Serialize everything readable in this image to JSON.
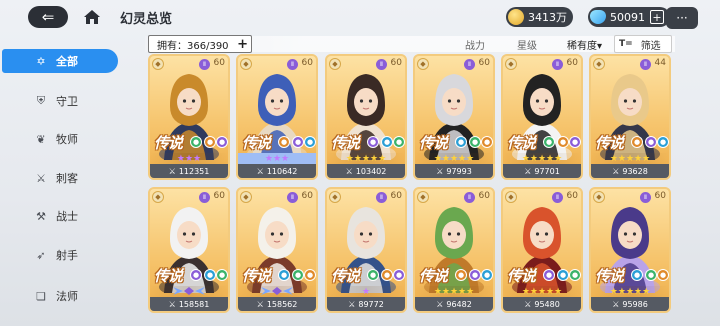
{
  "header": {
    "back_icon": "back-arrow-icon",
    "home_icon": "home-icon",
    "title": "幻灵总览",
    "gold": "3413万",
    "gems": "50091",
    "plus": "+",
    "chat_icon": "chat-icon"
  },
  "sidebar": {
    "items": [
      {
        "label": "全部",
        "icon": "star-icon",
        "glyph": "✡"
      },
      {
        "label": "守卫",
        "icon": "shield-icon",
        "glyph": "⛨"
      },
      {
        "label": "牧师",
        "icon": "wings-icon",
        "glyph": "❦"
      },
      {
        "label": "刺客",
        "icon": "dagger-icon",
        "glyph": "⚔"
      },
      {
        "label": "战士",
        "icon": "sword-icon",
        "glyph": "⚒"
      },
      {
        "label": "射手",
        "icon": "bow-icon",
        "glyph": "➶"
      },
      {
        "label": "法师",
        "icon": "book-icon",
        "glyph": "❏"
      }
    ]
  },
  "toolbar": {
    "owned": "拥有：366/390",
    "owned_plus": "+",
    "sort_power": "战力",
    "sort_star": "星级",
    "sort_rarity": "稀有度▾",
    "filter_icon": "T=",
    "filter": "筛选"
  },
  "cards": [
    {
      "level": "60",
      "rarity": "传说",
      "stars": "★★★",
      "star_style": "purple",
      "power": "112351",
      "colors": [
        "#c98a2b",
        "#2f3a5e"
      ]
    },
    {
      "level": "60",
      "rarity": "传说",
      "stars": "★★★",
      "star_style": "bluebar",
      "power": "110642",
      "colors": [
        "#3e5fb8",
        "#e8d9c2"
      ]
    },
    {
      "level": "60",
      "rarity": "传说",
      "stars": "★★★★★",
      "star_style": "gold",
      "power": "103402",
      "colors": [
        "#3a2a25",
        "#f0e2d0"
      ]
    },
    {
      "level": "60",
      "rarity": "传说",
      "stars": "★★★★★",
      "star_style": "gold",
      "power": "97993",
      "colors": [
        "#d8d8dc",
        "#222"
      ]
    },
    {
      "level": "60",
      "rarity": "传说",
      "stars": "★★★★★",
      "star_style": "gold",
      "power": "97701",
      "colors": [
        "#222",
        "#f3f3f3"
      ]
    },
    {
      "level": "44",
      "rarity": "传说",
      "stars": "★★★★★",
      "star_style": "gold",
      "power": "93628",
      "colors": [
        "#e9c98a",
        "#34374a"
      ]
    },
    {
      "level": "60",
      "rarity": "传说",
      "stars": "",
      "star_style": "gold",
      "power": "158581",
      "colors": [
        "#f2f2f2",
        "#3a3030"
      ]
    },
    {
      "level": "60",
      "rarity": "传说",
      "stars": "",
      "star_style": "gold",
      "power": "158562",
      "colors": [
        "#f4f1ea",
        "#7a3b2a"
      ]
    },
    {
      "level": "60",
      "rarity": "传说",
      "stars": "★",
      "star_style": "purple",
      "power": "89772",
      "colors": [
        "#e8e4de",
        "#33528a"
      ]
    },
    {
      "level": "60",
      "rarity": "传说",
      "stars": "★★★★★",
      "star_style": "gold",
      "power": "96482",
      "colors": [
        "#6aa84f",
        "#c07a2a"
      ]
    },
    {
      "level": "60",
      "rarity": "传说",
      "stars": "★★★★★",
      "star_style": "gold",
      "power": "95480",
      "colors": [
        "#d9532c",
        "#7a1c1c"
      ]
    },
    {
      "level": "60",
      "rarity": "传说",
      "stars": "★★★★★",
      "star_style": "gold",
      "power": "95986",
      "colors": [
        "#4a3a8a",
        "#b9a3e8"
      ]
    }
  ]
}
